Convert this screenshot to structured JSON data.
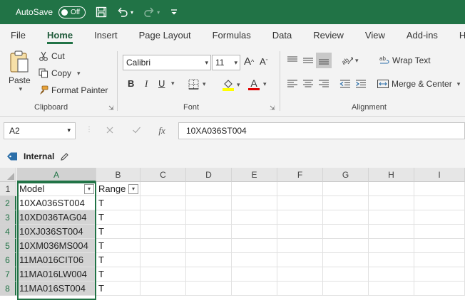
{
  "titlebar": {
    "autosave_label": "AutoSave",
    "autosave_state": "Off"
  },
  "menu": {
    "items": [
      "File",
      "Home",
      "Insert",
      "Page Layout",
      "Formulas",
      "Data",
      "Review",
      "View",
      "Add-ins",
      "Help"
    ],
    "active": "Home"
  },
  "ribbon": {
    "clipboard": {
      "paste": "Paste",
      "cut": "Cut",
      "copy": "Copy",
      "format_painter": "Format Painter",
      "label": "Clipboard"
    },
    "font": {
      "font_name": "Calibri",
      "font_size": "11",
      "grow": "A",
      "shrink": "A",
      "bold": "B",
      "italic": "I",
      "underline": "U",
      "font_color_letter": "A",
      "label": "Font",
      "highlight_color": "#ffff00",
      "font_color": "#e00000"
    },
    "alignment": {
      "wrap_text": "Wrap Text",
      "merge_center": "Merge & Center",
      "label": "Alignment"
    }
  },
  "formula_bar": {
    "name_box": "A2",
    "fx": "fx",
    "content": "10XA036ST004"
  },
  "label_bar": {
    "sensitivity": "Internal"
  },
  "sheet": {
    "columns": [
      "A",
      "B",
      "C",
      "D",
      "E",
      "F",
      "G",
      "H",
      "I"
    ],
    "rows": [
      "1",
      "2",
      "3",
      "4",
      "5",
      "6",
      "7",
      "8"
    ],
    "header_row": [
      "Model",
      "Range"
    ],
    "data": [
      [
        "10XA036ST004",
        "T"
      ],
      [
        "10XD036TAG04",
        "T"
      ],
      [
        "10XJ036ST004",
        "T"
      ],
      [
        "10XM036MS004",
        "T"
      ],
      [
        "11MA016CIT06",
        "T"
      ],
      [
        "11MA016LW004",
        "T"
      ],
      [
        "11MA016ST004",
        "T"
      ]
    ],
    "selected_column": "A",
    "active_cell": "A2"
  },
  "colors": {
    "accent": "#217346"
  }
}
